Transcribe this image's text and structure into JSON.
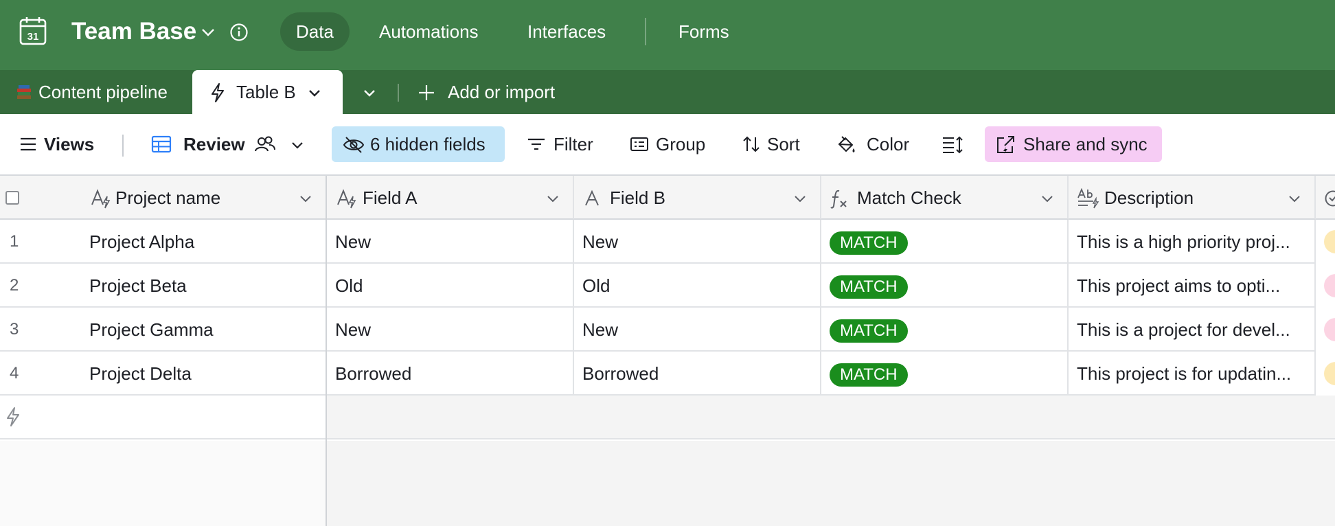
{
  "app": {
    "base_name": "Team Base",
    "logo_day": "31"
  },
  "nav": {
    "items": [
      {
        "label": "Data",
        "active": true
      },
      {
        "label": "Automations",
        "active": false
      },
      {
        "label": "Interfaces",
        "active": false
      },
      {
        "label": "Forms",
        "active": false
      }
    ]
  },
  "tables": {
    "items": [
      {
        "label": "Content pipeline",
        "icon": "books-emoji-icon",
        "active": false
      },
      {
        "label": "Table B",
        "icon": "bolt-icon",
        "active": true
      }
    ],
    "add_label": "Add or import"
  },
  "toolbar": {
    "views_label": "Views",
    "view_name": "Review",
    "hidden_fields_label": "6 hidden fields",
    "filter_label": "Filter",
    "group_label": "Group",
    "sort_label": "Sort",
    "color_label": "Color",
    "share_label": "Share and sync",
    "colors": {
      "hidden_bg": "#c4e6f9",
      "share_bg": "#f6ccf4"
    }
  },
  "grid": {
    "columns": [
      {
        "label": "Project name",
        "icon": "ai-text-icon"
      },
      {
        "label": "Field A",
        "icon": "ai-text-icon"
      },
      {
        "label": "Field B",
        "icon": "text-icon"
      },
      {
        "label": "Match Check",
        "icon": "formula-icon"
      },
      {
        "label": "Description",
        "icon": "long-text-icon"
      }
    ],
    "rows": [
      {
        "num": "1",
        "project": "Project Alpha",
        "field_a": "New",
        "field_b": "New",
        "match": "MATCH",
        "description": "This is a high priority proj...",
        "status_color": "#fde9b4"
      },
      {
        "num": "2",
        "project": "Project Beta",
        "field_a": "Old",
        "field_b": "Old",
        "match": "MATCH",
        "description": "This project aims to opti...",
        "status_color": "#fcd4e3"
      },
      {
        "num": "3",
        "project": "Project Gamma",
        "field_a": "New",
        "field_b": "New",
        "match": "MATCH",
        "description": "This is a project for devel...",
        "status_color": "#fcd4e3"
      },
      {
        "num": "4",
        "project": "Project Delta",
        "field_a": "Borrowed",
        "field_b": "Borrowed",
        "match": "MATCH",
        "description": "This project is for updatin...",
        "status_color": "#fde9b4"
      }
    ],
    "colors": {
      "match_bg": "#1a8d1d",
      "topbar": "#40804a",
      "tabbar": "#356b3c"
    }
  }
}
